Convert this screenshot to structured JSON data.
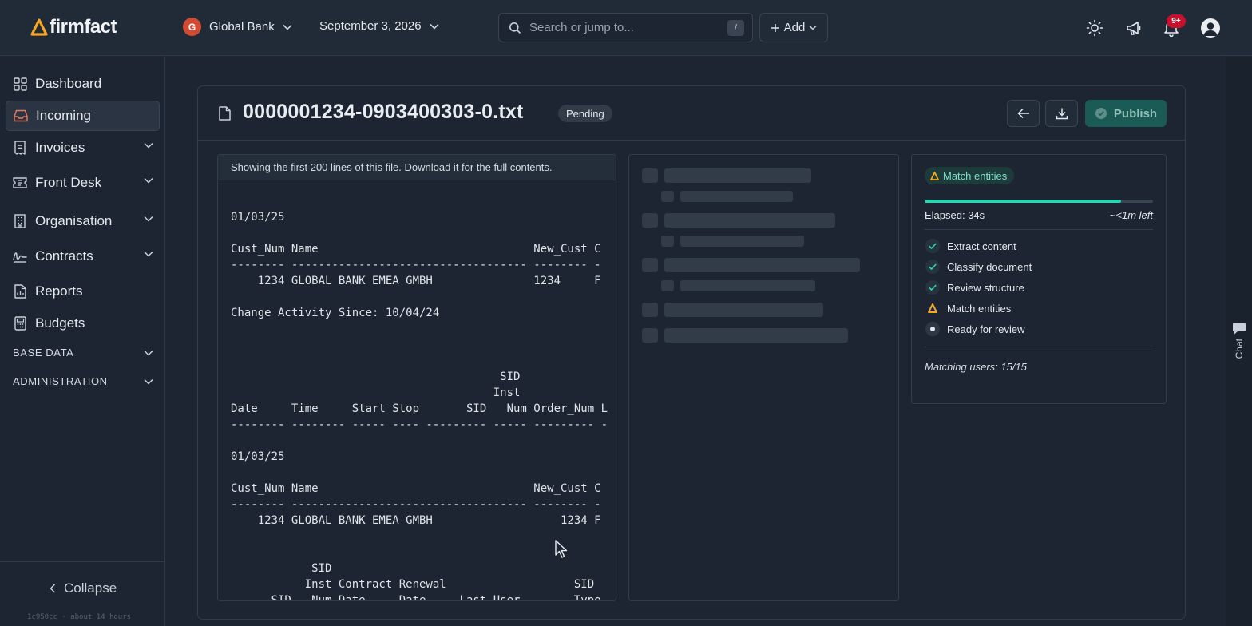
{
  "app": {
    "brand": "firmfact",
    "org_initial": "G",
    "org_name": "Global Bank",
    "date": "September 3, 2026",
    "search_placeholder": "Search or jump to...",
    "search_shortcut": "/",
    "add_label": "Add",
    "notifications_badge": "9+"
  },
  "sidebar": {
    "items": [
      {
        "label": "Dashboard",
        "icon": "grid-icon"
      },
      {
        "label": "Incoming",
        "icon": "inbox-icon",
        "active": true
      },
      {
        "label": "Invoices",
        "icon": "invoice-icon",
        "expandable": true
      },
      {
        "label": "Front Desk",
        "icon": "ticket-icon",
        "expandable": true
      },
      {
        "label": "Organisation",
        "icon": "building-icon",
        "expandable": true
      },
      {
        "label": "Contracts",
        "icon": "signature-icon",
        "expandable": true
      },
      {
        "label": "Reports",
        "icon": "report-icon"
      },
      {
        "label": "Budgets",
        "icon": "calculator-icon"
      }
    ],
    "sections": [
      "BASE DATA",
      "ADMINISTRATION"
    ],
    "collapse_label": "Collapse",
    "build_info": "1c950cc · about 14 hours"
  },
  "document": {
    "filename": "0000001234-0903400303-0.txt",
    "status": "Pending",
    "publish_label": "Publish",
    "notice": "Showing the first 200 lines of this file. Download it for the full contents.",
    "lines": [
      "01/03/25",
      "",
      "Cust_Num Name                                New_Cust C",
      "-------- ----------------------------------- -------- -",
      "    1234 GLOBAL BANK EMEA GMBH               1234     F",
      "",
      "Change Activity Since: 10/04/24",
      "",
      "",
      "",
      "                                        SID",
      "                                       Inst",
      "Date     Time     Start Stop       SID   Num Order_Num L",
      "-------- -------- ----- ---- --------- ----- --------- -",
      "",
      "01/03/25",
      "",
      "Cust_Num Name                                New_Cust C",
      "-------- ----------------------------------- -------- -",
      "    1234 GLOBAL BANK EMEA GMBH                   1234 F",
      "",
      "",
      "            SID",
      "           Inst Contract Renewal                   SID",
      "      SID   Num Date     Date     Last User        Type"
    ]
  },
  "progress": {
    "current_step": "Match entities",
    "percent": 86,
    "elapsed": "Elapsed: 34s",
    "remaining": "~<1m left",
    "steps": [
      {
        "label": "Extract content",
        "state": "done"
      },
      {
        "label": "Classify document",
        "state": "done"
      },
      {
        "label": "Review structure",
        "state": "done"
      },
      {
        "label": "Match entities",
        "state": "warning"
      },
      {
        "label": "Ready for review",
        "state": "pending"
      }
    ],
    "matching_users": "Matching users: 15/15"
  },
  "chat_label": "Chat",
  "colors": {
    "accent": "#2ed3b1",
    "brand": "#f5a623",
    "badge": "#c8102e",
    "publish": "#1b5b56"
  }
}
